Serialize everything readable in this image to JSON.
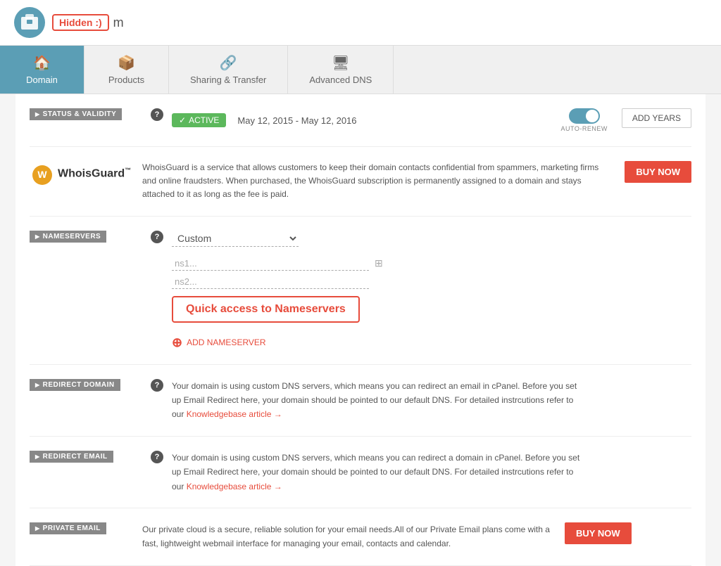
{
  "header": {
    "hidden_label": "Hidden :)",
    "domain_suffix": "m"
  },
  "tabs": [
    {
      "id": "domain",
      "label": "Domain",
      "icon": "🏠",
      "active": true
    },
    {
      "id": "products",
      "label": "Products",
      "icon": "📦",
      "active": false
    },
    {
      "id": "sharing",
      "label": "Sharing & Transfer",
      "icon": "🔗",
      "active": false
    },
    {
      "id": "advanced-dns",
      "label": "Advanced DNS",
      "icon": "🖥",
      "active": false
    }
  ],
  "sections": {
    "status": {
      "label": "STATUS & VALIDITY",
      "status_text": "ACTIVE",
      "date_range": "May 12, 2015 - May 12, 2016",
      "auto_renew_label": "AUTO-RENEW",
      "add_years_btn": "ADD YEARS"
    },
    "whoisguard": {
      "logo_text": "WhoisGuard",
      "tm": "™",
      "description": "WhoisGuard is a service that allows customers to keep their domain contacts confidential from spammers, marketing firms and online fraudsters. When purchased, the WhoisGuard subscription is permanently assigned to a domain and stays attached to it as long as the fee is paid.",
      "buy_btn": "BUY NOW"
    },
    "nameservers": {
      "label": "NAMESERVERS",
      "dropdown_value": "Custom",
      "ns1_placeholder": "ns1...",
      "ns2_placeholder": "ns2...",
      "quick_access_text": "Quick access to Nameservers",
      "add_ns_btn": "ADD NAMESERVER"
    },
    "redirect_domain": {
      "label": "REDIRECT DOMAIN",
      "description": "Your domain is using custom DNS servers, which means you can redirect an email in cPanel. Before you set up Email Redirect here, your domain should be pointed to our default DNS. For detailed instrcutions refer to our",
      "link_text": "Knowledgebase article →"
    },
    "redirect_email": {
      "label": "REDIRECT EMAIL",
      "description": "Your domain is using custom DNS servers, which means you can redirect a domain in cPanel. Before you set up Email Redirect here, your domain should be pointed to our default DNS. For detailed instrcutions refer to our",
      "link_text": "Knowledgebase article →"
    },
    "private_email": {
      "label": "PRIVATE EMAIL",
      "description": "Our private cloud is a secure, reliable solution for your email needs.All of our Private Email plans come with a fast, lightweight webmail interface for managing your email, contacts and calendar.",
      "buy_btn": "BUY NOW"
    }
  }
}
